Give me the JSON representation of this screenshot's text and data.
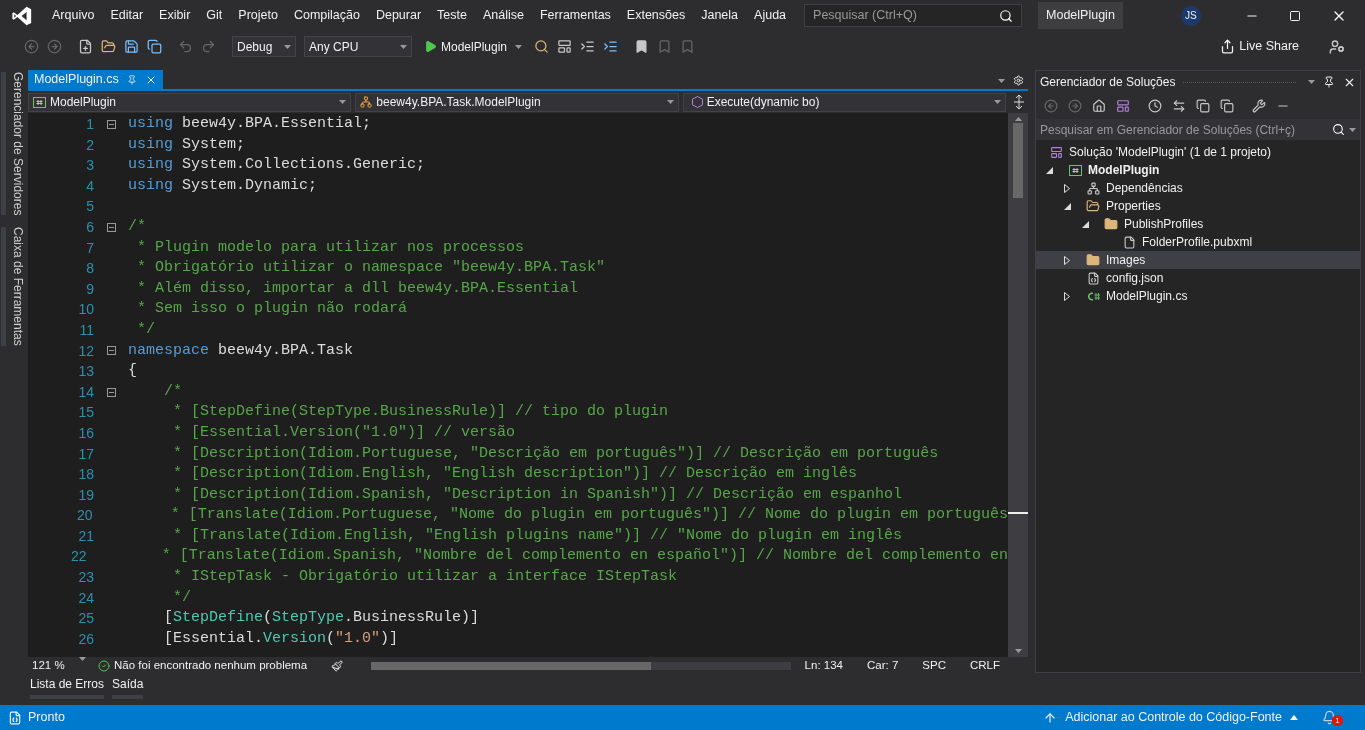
{
  "menu": [
    "Arquivo",
    "Editar",
    "Exibir",
    "Git",
    "Projeto",
    "Compilação",
    "Depurar",
    "Teste",
    "Análise",
    "Ferramentas",
    "Extensões",
    "Janela",
    "Ajuda"
  ],
  "search": {
    "placeholder": "Pesquisar (Ctrl+Q)"
  },
  "solution_name": "ModelPlugin",
  "avatar": "JS",
  "toolbar": {
    "configuration": "Debug",
    "platform": "Any CPU",
    "run_target": "ModelPlugin",
    "live_share": "Live Share"
  },
  "side_tabs": [
    "Gerenciador de Servidores",
    "Caixa de Ferramentas"
  ],
  "editor": {
    "tab": {
      "title": "ModelPlugin.cs",
      "selected": true
    },
    "nav": [
      "ModelPlugin",
      "beew4y.BPA.Task.ModelPlugin",
      "Execute(dynamic bo)"
    ],
    "lines": [
      {
        "number": "1",
        "fold": true,
        "tokens": [
          {
            "kind": "kw",
            "text": "using"
          },
          {
            "kind": "plain",
            "text": " beew4y.BPA.Essential;"
          }
        ]
      },
      {
        "number": "2",
        "fold": false,
        "tokens": [
          {
            "kind": "kw",
            "text": "using"
          },
          {
            "kind": "plain",
            "text": " System;"
          }
        ]
      },
      {
        "number": "3",
        "fold": false,
        "tokens": [
          {
            "kind": "kw",
            "text": "using"
          },
          {
            "kind": "plain",
            "text": " System.Collections.Generic;"
          }
        ]
      },
      {
        "number": "4",
        "fold": false,
        "tokens": [
          {
            "kind": "kw",
            "text": "using"
          },
          {
            "kind": "plain",
            "text": " System.Dynamic;"
          }
        ]
      },
      {
        "number": "5",
        "fold": false
      },
      {
        "number": "6",
        "fold": true,
        "tokens": [
          {
            "kind": "comment",
            "text": "/*"
          }
        ]
      },
      {
        "number": "7",
        "fold": false,
        "tokens": [
          {
            "kind": "comment",
            "text": " * Plugin modelo para utilizar nos processos"
          }
        ]
      },
      {
        "number": "8",
        "fold": false,
        "tokens": [
          {
            "kind": "comment",
            "text": " * Obrigatório utilizar o namespace \"beew4y.BPA.Task\""
          }
        ]
      },
      {
        "number": "9",
        "fold": false,
        "tokens": [
          {
            "kind": "comment",
            "text": " * Além disso, importar a dll beew4y.BPA.Essential"
          }
        ]
      },
      {
        "number": "10",
        "fold": false,
        "tokens": [
          {
            "kind": "comment",
            "text": " * Sem isso o plugin não rodará"
          }
        ]
      },
      {
        "number": "11",
        "fold": false,
        "tokens": [
          {
            "kind": "comment",
            "text": " */"
          }
        ]
      },
      {
        "number": "12",
        "fold": true,
        "tokens": [
          {
            "kind": "kw",
            "text": "namespace"
          },
          {
            "kind": "plain",
            "text": " beew4y.BPA.Task"
          }
        ]
      },
      {
        "number": "13",
        "fold": false,
        "tokens": [
          {
            "kind": "plain",
            "text": "{"
          }
        ]
      },
      {
        "number": "14",
        "fold": true,
        "tokens": [
          {
            "kind": "comment",
            "text": "    /*"
          }
        ]
      },
      {
        "number": "15",
        "fold": false,
        "tokens": [
          {
            "kind": "comment",
            "text": "     * [StepDefine(StepType.BusinessRule)] // tipo do plugin"
          }
        ]
      },
      {
        "number": "16",
        "fold": false,
        "tokens": [
          {
            "kind": "comment",
            "text": "     * [Essential.Version(\"1.0\")] // versão"
          }
        ]
      },
      {
        "number": "17",
        "fold": false,
        "tokens": [
          {
            "kind": "comment",
            "text": "     * [Description(Idiom.Portuguese, \"Descrição em português\")] // Descrição em português"
          }
        ]
      },
      {
        "number": "18",
        "fold": false,
        "tokens": [
          {
            "kind": "comment",
            "text": "     * [Description(Idiom.English, \"English description\")] // Descrição em inglês"
          }
        ]
      },
      {
        "number": "19",
        "fold": false,
        "tokens": [
          {
            "kind": "comment",
            "text": "     * [Description(Idiom.Spanish, \"Description in Spanish\")] // Descrição em espanhol"
          }
        ]
      },
      {
        "number": "20",
        "fold": false,
        "tokens": [
          {
            "kind": "comment",
            "text": "     * [Translate(Idiom.Portuguese, \"Nome do plugin em português\")] // Nome do plugin em português"
          }
        ]
      },
      {
        "number": "21",
        "fold": false,
        "tokens": [
          {
            "kind": "comment",
            "text": "     * [Translate(Idiom.English, \"English plugins name\")] // \"Nome do plugin em inglês"
          }
        ]
      },
      {
        "number": "22",
        "fold": false,
        "tokens": [
          {
            "kind": "comment",
            "text": "     * [Translate(Idiom.Spanish, \"Nombre del complemento en español\")] // Nombre del complemento en"
          }
        ]
      },
      {
        "number": "23",
        "fold": false,
        "tokens": [
          {
            "kind": "comment",
            "text": "     * IStepTask - Obrigatório utilizar a interface IStepTask"
          }
        ]
      },
      {
        "number": "24",
        "fold": false,
        "tokens": [
          {
            "kind": "comment",
            "text": "     */"
          }
        ]
      },
      {
        "number": "25",
        "fold": false,
        "tokens": [
          {
            "kind": "plain",
            "text": "    ["
          },
          {
            "kind": "type",
            "text": "StepDefine"
          },
          {
            "kind": "plain",
            "text": "("
          },
          {
            "kind": "type",
            "text": "StepType"
          },
          {
            "kind": "plain",
            "text": ".BusinessRule)]"
          }
        ]
      },
      {
        "number": "26",
        "fold": false,
        "tokens": [
          {
            "kind": "plain",
            "text": "    [Essential."
          },
          {
            "kind": "type",
            "text": "Version"
          },
          {
            "kind": "plain",
            "text": "("
          },
          {
            "kind": "string",
            "text": "\"1.0\""
          },
          {
            "kind": "plain",
            "text": ")]"
          }
        ]
      }
    ],
    "status": {
      "zoom": "121 %",
      "issues": "Não foi encontrado nenhum problema",
      "line": "Ln: 134",
      "column": "Car: 7",
      "whitespace": "SPC",
      "line_ending": "CRLF"
    }
  },
  "bottom_tabs": [
    {
      "label": "Lista de Erros",
      "selected": false
    },
    {
      "label": "Saída",
      "selected": false
    }
  ],
  "solution_explorer": {
    "title": "Gerenciador de Soluções",
    "search": {
      "placeholder": "Pesquisar em Gerenciador de Soluções (Ctrl+ç)"
    },
    "solution": "Solução 'ModelPlugin' (1 de 1 projeto)",
    "tree": [
      {
        "label": "ModelPlugin",
        "kind": "project",
        "expanded": true,
        "selected": false,
        "children": [
          {
            "label": "Dependências",
            "kind": "dependencies",
            "expanded": false,
            "selected": false
          },
          {
            "label": "Properties",
            "kind": "properties",
            "expanded": true,
            "selected": false,
            "children": [
              {
                "label": "PublishProfiles",
                "kind": "folder",
                "expanded": true,
                "selected": false,
                "children": [
                  {
                    "label": "FolderProfile.pubxml",
                    "kind": "file",
                    "selected": false
                  }
                ]
              }
            ]
          },
          {
            "label": "Images",
            "kind": "folder",
            "expanded": false,
            "selected": true
          },
          {
            "label": "config.json",
            "kind": "json",
            "selected": false
          },
          {
            "label": "ModelPlugin.cs",
            "kind": "csharp",
            "expanded": false,
            "selected": false
          }
        ]
      }
    ]
  },
  "status_bar": {
    "state": "Pronto",
    "source_control": "Adicionar ao Controle do Código-Fonte",
    "notifications": "1"
  }
}
